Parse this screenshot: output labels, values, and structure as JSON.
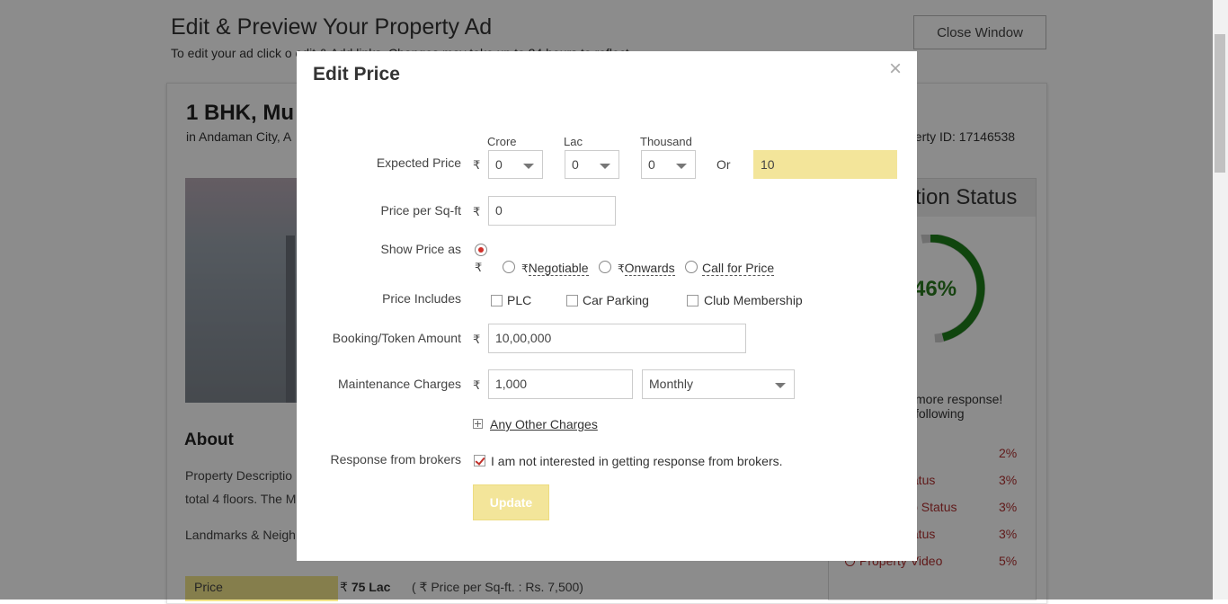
{
  "background": {
    "title": "Edit & Preview Your Property Ad",
    "subtitle": "To edit your ad click o              edit & Add links. Changes may take up to 24 hours to reflect.",
    "close_button": "Close Window",
    "property_title": "1 BHK, Mu",
    "property_location": "in Andaman City, A",
    "property_id": "perty ID: 17146538",
    "about_heading": "About",
    "desc_line1": "Property Descriptio",
    "desc_line2": "total 4 floors. The M",
    "landmarks": "Landmarks & Neigh",
    "price_label": "Price",
    "price_rupee": "₹",
    "price_value": "75 Lac",
    "price_per_sqft": "( ₹  Price per Sq-ft. : Rs. 7,500)",
    "status_heading": "tion Status",
    "status_percent": "46%",
    "status_progress": 0.46,
    "more_response_1": "more response!",
    "more_response_2": "following",
    "status_rows": [
      {
        "label": "",
        "pct": "2%"
      },
      {
        "label": "tatus",
        "pct": "3%"
      },
      {
        "label": "ip Status",
        "pct": "3%"
      },
      {
        "label": "tatus",
        "pct": "3%"
      },
      {
        "label": "Property Video",
        "pct": "5%"
      }
    ]
  },
  "modal": {
    "title": "Edit Price",
    "close_glyph": "×",
    "rupee": "₹",
    "expected_price": {
      "label": "Expected Price",
      "crore_label": "Crore",
      "lac_label": "Lac",
      "thousand_label": "Thousand",
      "crore_value": "0",
      "lac_value": "0",
      "thousand_value": "0",
      "or_label": "Or",
      "total_value": "10"
    },
    "price_per_sqft": {
      "label": "Price per Sq-ft",
      "value": "0"
    },
    "show_price_as": {
      "label": "Show Price as",
      "options": [
        "Negotiable",
        "Onwards",
        "Call for Price"
      ]
    },
    "price_includes": {
      "label": "Price Includes",
      "options": [
        "PLC",
        "Car Parking",
        "Club Membership"
      ]
    },
    "booking_amount": {
      "label": "Booking/Token Amount",
      "value": "10,00,000"
    },
    "maintenance": {
      "label": "Maintenance Charges",
      "value": "1,000",
      "period": "Monthly"
    },
    "other_charges_link": "Any Other Charges",
    "brokers": {
      "label": "Response from brokers",
      "checkbox_text": "I am not interested in getting response from brokers."
    },
    "update_button": "Update"
  }
}
